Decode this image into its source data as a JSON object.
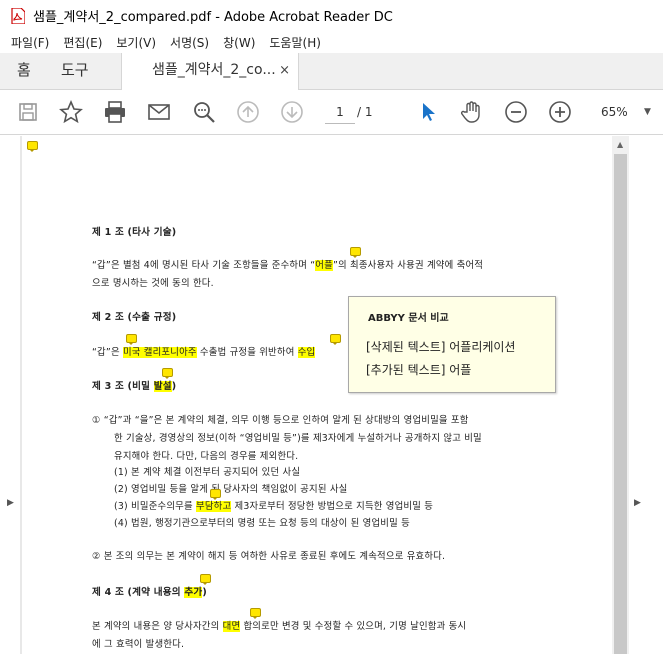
{
  "window": {
    "title": "샘플_계약서_2_compared.pdf - Adobe Acrobat Reader DC"
  },
  "menu": [
    "파일(F)",
    "편집(E)",
    "보기(V)",
    "서명(S)",
    "창(W)",
    "도움말(H)"
  ],
  "tabs": {
    "home": "홈",
    "tools": "도구",
    "doc": "샘플_계약서_2_co...",
    "close": "×"
  },
  "toolbar": {
    "page_current": "1",
    "page_total": "/ 1",
    "zoom": "65%"
  },
  "popup": {
    "title": "ABBYY 문서 비교",
    "line1": "[삭제된 텍스트] 어플리케이션",
    "line2": "[추가된 텍스트] 어플"
  },
  "doc": {
    "a1_title": "제 1 조  (타사 기술)",
    "a1_l1a": "“갑”은 별첨 4에 명시된 타사 기술 조항들을 준수하며 “",
    "a1_l1hl": "어플",
    "a1_l1b": "”의 최종사용자 사용권 계약에 축어적",
    "a1_l2": "으로 명시하는 것에 동의 한다.",
    "a2_title": "제 2 조  (수출 규정)",
    "a2_l1a": "“갑”은 ",
    "a2_l1hl": "미국 캘리포니아주",
    "a2_l1b": " 수출법 규정을 위반하여 ",
    "a2_l1hl2": "수입",
    "a3_title_a": "제 3 조  (비밀 ",
    "a3_title_hl": "발설",
    "a3_title_b": ")",
    "a3_p1_l1": "①  “갑”과 “을”은 본 계약의 체결, 의무 이행 등으로 인하여 알게 된 상대방의 영업비밀을 포함",
    "a3_p1_l2": "한 기술상, 경영상의 정보(이하 “영업비밀 등”)를 제3자에게 누설하거나 공개하지 않고 비밀",
    "a3_p1_l3": "유지해야 한다. 다만, 다음의 경우를 제외한다.",
    "a3_i1": "(1)   본 계약 체결 이전부터 공지되어 있던 사실",
    "a3_i2": "(2)   영업비밀 등을 알게 된 당사자의 책임없이 공지된 사실",
    "a3_i3a": "(3)   비밀준수의무를 ",
    "a3_i3hl": "부담하고",
    "a3_i3b": " 제3자로부터 정당한 방법으로 지득한 영업비밀 등",
    "a3_i4": "(4)   법원, 행정기관으로부터의 명령 또는 요청 등의 대상이 된 영업비밀 등",
    "a3_p2": "②  본 조의 의무는 본 계약이 해지 등 여하한 사유로 종료된 후에도 계속적으로 유효하다.",
    "a4_title_a": "제 4 조   (계약 내용의 ",
    "a4_title_hl": "추가",
    "a4_title_b": ")",
    "a4_l1a": "본 계약의 내용은 양 당사자간의 ",
    "a4_l1hl": "대면",
    "a4_l1b": " 합의로만 변경 및 수정할 수 있으며, 기명 날인함과 동시",
    "a4_l2": "에 그 효력이 발생한다."
  }
}
